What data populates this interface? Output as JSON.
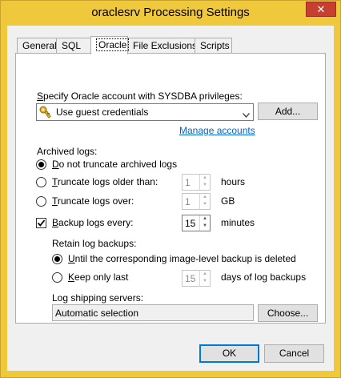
{
  "window": {
    "title": "oraclesrv Processing Settings",
    "close_glyph": "✕"
  },
  "tabs": [
    {
      "label": "General"
    },
    {
      "label": "SQL"
    },
    {
      "label": "Oracle"
    },
    {
      "label": "File Exclusions"
    },
    {
      "label": "Scripts"
    }
  ],
  "oracle": {
    "account_label": "Specify Oracle account with SYSDBA privileges:",
    "account_value": "Use guest credentials",
    "add_button": "Add...",
    "manage_accounts": "Manage accounts",
    "archived_logs_label": "Archived logs:",
    "options": {
      "no_truncate": "Do not truncate archived logs",
      "truncate_older": "Truncate logs older than:",
      "truncate_over": "Truncate logs over:",
      "selected": "no_truncate"
    },
    "older_value": "1",
    "older_unit": "hours",
    "over_value": "1",
    "over_unit": "GB",
    "backup_logs_label": "Backup logs every:",
    "backup_logs_checked": true,
    "backup_value": "15",
    "backup_unit": "minutes",
    "retain_label": "Retain log backups:",
    "retain_options": {
      "until_deleted": "Until the corresponding image-level backup is deleted",
      "keep_only_last": "Keep only last",
      "selected": "until_deleted"
    },
    "keep_value": "15",
    "keep_unit": "days of log backups",
    "shipping_label": "Log shipping servers:",
    "shipping_value": "Automatic selection",
    "choose_button": "Choose..."
  },
  "footer": {
    "ok": "OK",
    "cancel": "Cancel"
  },
  "colors": {
    "title_bar": "#f0c83c",
    "close": "#c7402f",
    "link": "#0066cc",
    "focus": "#0078d7"
  }
}
